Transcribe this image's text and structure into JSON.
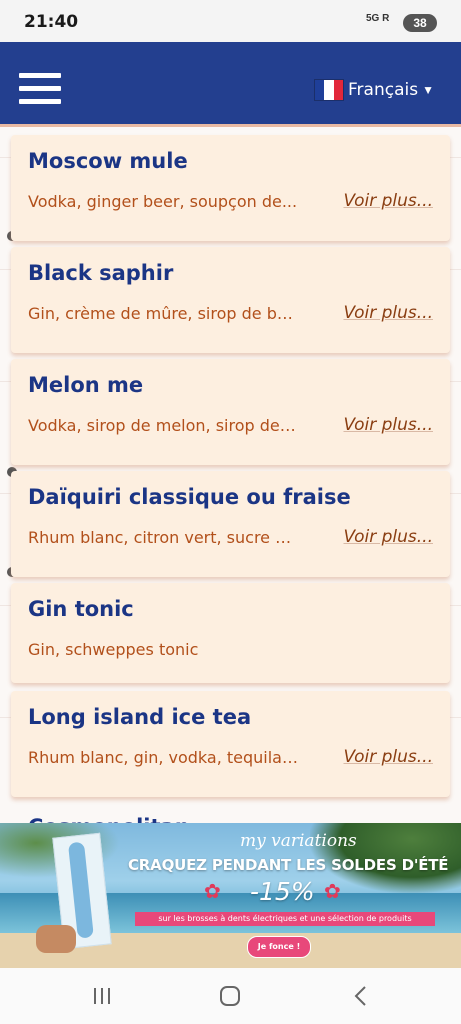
{
  "status_bar": {
    "time": "21:40",
    "network": "5G R",
    "battery": "38"
  },
  "header": {
    "language": "Français",
    "flag_colors": [
      "#1f3f99",
      "#ffffff",
      "#e2273a"
    ]
  },
  "cocktails": [
    {
      "name": "Moscow mule",
      "ingredients": "Vodka, ginger beer, soupçon de...",
      "more": "Voir plus..."
    },
    {
      "name": "Black saphir",
      "ingredients": "Gin, crème de mûre, sirop de bu...",
      "more": "Voir plus..."
    },
    {
      "name": "Melon me",
      "ingredients": "Vodka, sirop de melon, sirop de ...",
      "more": "Voir plus..."
    },
    {
      "name": "Daïquiri classique ou fraise",
      "ingredients": "Rhum blanc, citron vert, sucre d...",
      "more": "Voir plus..."
    },
    {
      "name": "Gin tonic",
      "ingredients": "Gin, schweppes tonic",
      "more": ""
    },
    {
      "name": "Long island ice tea",
      "ingredients": "Rhum blanc, gin, vodka, tequila,...",
      "more": "Voir plus..."
    }
  ],
  "partial_item": "Cosmopolitan",
  "ad": {
    "brand": "my variations",
    "headline": "CRAQUEZ PENDANT LES SOLDES D'ÉTÉ",
    "discount": "-15%",
    "subtext": "sur les brosses à dents électriques et une sélection de produits",
    "cta": "Je fonce !"
  },
  "colors": {
    "header": "#233f8f",
    "card": "#fdefe0",
    "title": "#1b3585",
    "ingredients": "#b2501b"
  }
}
